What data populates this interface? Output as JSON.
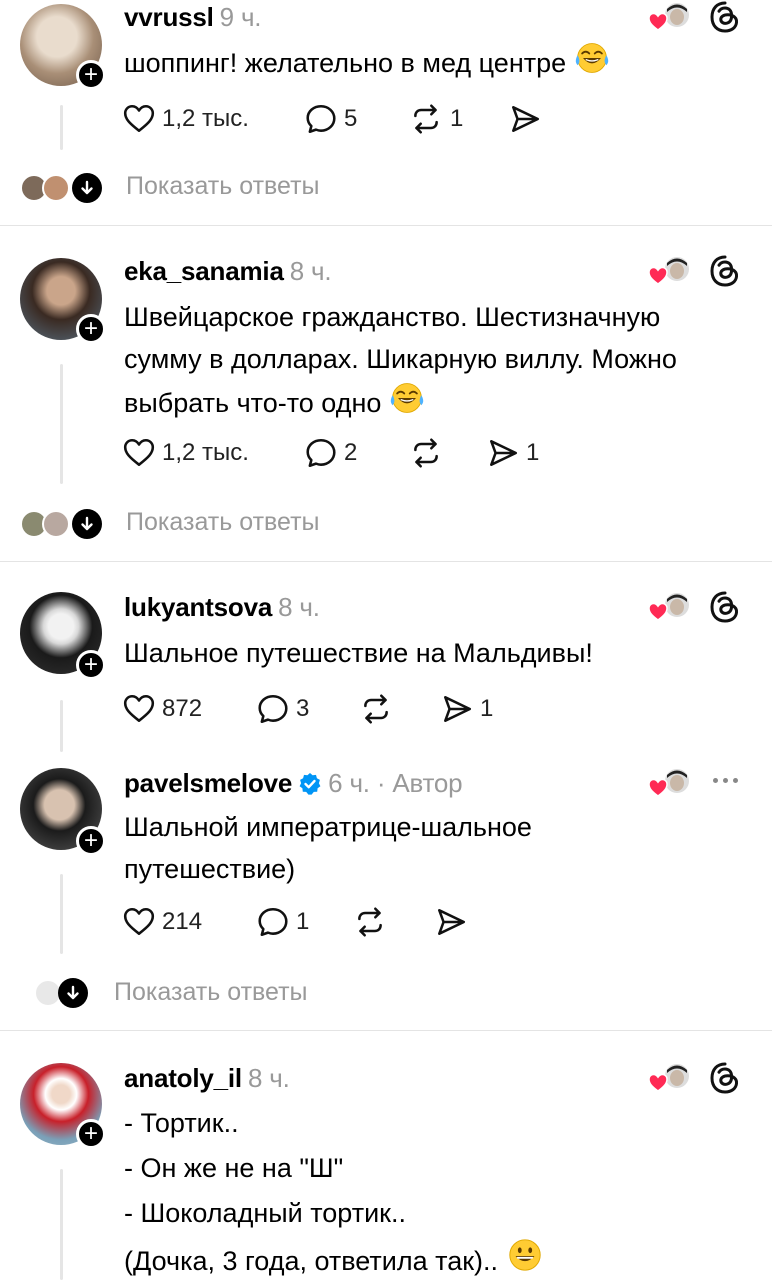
{
  "comments": [
    {
      "username": "vvrussl",
      "time": "9 ч.",
      "lines": [
        "шоппинг! желательно в мед центре"
      ],
      "emoji": "laugh-tears",
      "likes": "1,2 тыс.",
      "replies": "5",
      "reposts": "1",
      "shares": "",
      "show_replies": "Показать ответы"
    },
    {
      "username": "eka_sanamia",
      "time": "8 ч.",
      "lines": [
        "Швейцарское гражданство. Шестизначную",
        "сумму в долларах. Шикарную виллу. Можно",
        "выбрать что-то одно"
      ],
      "emoji": "laugh-tears",
      "likes": "1,2 тыс.",
      "replies": "2",
      "reposts": "",
      "shares": "1",
      "show_replies": "Показать ответы"
    },
    {
      "username": "lukyantsova",
      "time": "8 ч.",
      "lines": [
        "Шальное путешествие на Мальдивы!"
      ],
      "likes": "872",
      "replies": "3",
      "reposts": "",
      "shares": "1"
    },
    {
      "username": "pavelsmelove",
      "time": "6 ч. · Автор",
      "verified": true,
      "lines": [
        "Шальной императрице-шальное",
        "путешествие)"
      ],
      "likes": "214",
      "replies": "1",
      "reposts": "",
      "shares": "",
      "show_replies": "Показать ответы"
    },
    {
      "username": "anatoly_il",
      "time": "8 ч.",
      "lines": [
        "- Тортик..",
        "- Он же не на \"Ш\"",
        "- Шоколадный тортик..",
        "(Дочка, 3 года, ответила так).."
      ],
      "emoji": "grin"
    }
  ],
  "icons": {
    "like": "heart-outline-icon",
    "reply": "speech-bubble-icon",
    "repost": "repost-arrows-icon",
    "share": "send-icon",
    "threads": "threads-logo-icon",
    "more": "more-dots-icon",
    "verified": "verified-badge-icon"
  },
  "colors": {
    "text": "#000000",
    "muted": "#999999",
    "divider": "#e4e4e4",
    "heart": "#ff2a55",
    "verified": "#0095f6"
  }
}
